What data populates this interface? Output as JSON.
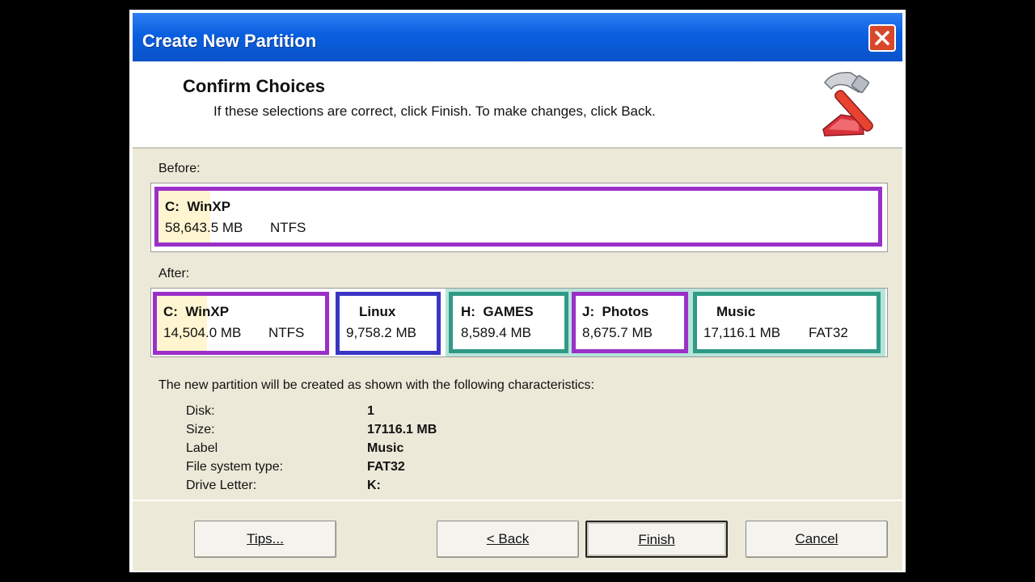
{
  "window": {
    "title": "Create New Partition"
  },
  "header": {
    "title": "Confirm Choices",
    "subtitle": "If these selections are correct, click Finish. To make changes, click Back."
  },
  "before": {
    "label": "Before:",
    "partitions": [
      {
        "name": "C:  WinXP",
        "size": "58,643.5 MB",
        "fs": "NTFS",
        "color": "#9b30c8"
      }
    ]
  },
  "after": {
    "label": "After:",
    "partitions": [
      {
        "name": "C:  WinXP",
        "size": "14,504.0 MB",
        "fs": "NTFS",
        "color": "#9b30c8"
      },
      {
        "name": "Linux",
        "size": "9,758.2 MB",
        "fs": "",
        "color": "#3a36c4"
      },
      {
        "name": "H:  GAMES",
        "size": "8,589.4 MB",
        "fs": "",
        "color": "#2f9a86"
      },
      {
        "name": "J:  Photos",
        "size": "8,675.7 MB",
        "fs": "",
        "color": "#9b30c8"
      },
      {
        "name": "Music",
        "size": "17,116.1 MB",
        "fs": "FAT32",
        "color": "#2f9a86"
      }
    ]
  },
  "characteristics": {
    "intro": "The new partition will be created as shown with the following characteristics:",
    "rows": [
      {
        "label": "Disk:",
        "value": "1"
      },
      {
        "label": "Size:",
        "value": "17116.1 MB"
      },
      {
        "label": "Label",
        "value": "Music"
      },
      {
        "label": "File system type:",
        "value": "FAT32"
      },
      {
        "label": "Drive Letter:",
        "value": "K:"
      }
    ]
  },
  "buttons": {
    "tips": "Tips...",
    "back": "< Back",
    "finish": "Finish",
    "cancel": "Cancel"
  }
}
